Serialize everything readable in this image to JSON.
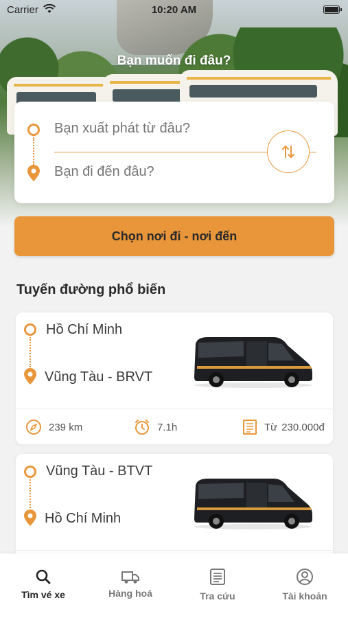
{
  "status_bar": {
    "carrier": "Carrier",
    "time": "10:20 AM"
  },
  "hero": {
    "title": "Bạn muốn đi đâu?"
  },
  "search": {
    "from_placeholder": "Bạn xuất phát từ đâu?",
    "to_placeholder": "Bạn đi đến đâu?",
    "submit_label": "Chọn nơi đi - nơi đến"
  },
  "popular": {
    "title": "Tuyến đường phổ biến",
    "routes": [
      {
        "from": "Hồ Chí Minh",
        "to": "Vũng Tàu - BRVT",
        "distance": "239 km",
        "duration": "7.1h",
        "price_prefix": "Từ",
        "price": "230.000đ"
      },
      {
        "from": "Vũng Tàu - BTVT",
        "to": "Hồ Chí Minh"
      }
    ]
  },
  "tabs": [
    {
      "label": "Tìm vé xe",
      "icon": "search-icon",
      "active": true
    },
    {
      "label": "Hàng hoá",
      "icon": "truck-icon",
      "active": false
    },
    {
      "label": "Tra cứu",
      "icon": "document-icon",
      "active": false
    },
    {
      "label": "Tài khoản",
      "icon": "account-icon",
      "active": false
    }
  ],
  "colors": {
    "accent": "#e9963a",
    "background": "#f2f2f2",
    "card": "#ffffff"
  }
}
